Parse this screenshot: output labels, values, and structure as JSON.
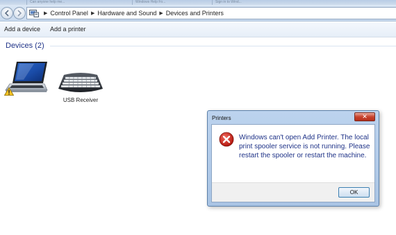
{
  "title_strip": {
    "tabs": [
      {
        "label": "Can anyone help me..."
      },
      {
        "label": "Windows Help Fo..."
      },
      {
        "label": "Sign in to Wind..."
      }
    ]
  },
  "addressbar": {
    "breadcrumb": [
      "Control Panel",
      "Hardware and Sound",
      "Devices and Printers"
    ]
  },
  "toolbar": {
    "add_device": "Add a device",
    "add_printer": "Add a printer"
  },
  "devices": {
    "header": "Devices (2)",
    "items": [
      {
        "name": "",
        "icon": "laptop-icon",
        "warning": true
      },
      {
        "name": "USB Receiver",
        "icon": "keyboard-icon",
        "warning": false
      }
    ]
  },
  "dialog": {
    "title": "Printers",
    "close_label": "✕",
    "message": "Windows can't open Add Printer. The local print spooler service is not running. Please restart the spooler or restart the machine.",
    "ok_label": "OK",
    "icon": "error-icon"
  },
  "colors": {
    "header_text": "#1e3287",
    "dialog_frame": "#a9c4e4",
    "close_red": "#c8432e",
    "error_red": "#d1231b"
  }
}
